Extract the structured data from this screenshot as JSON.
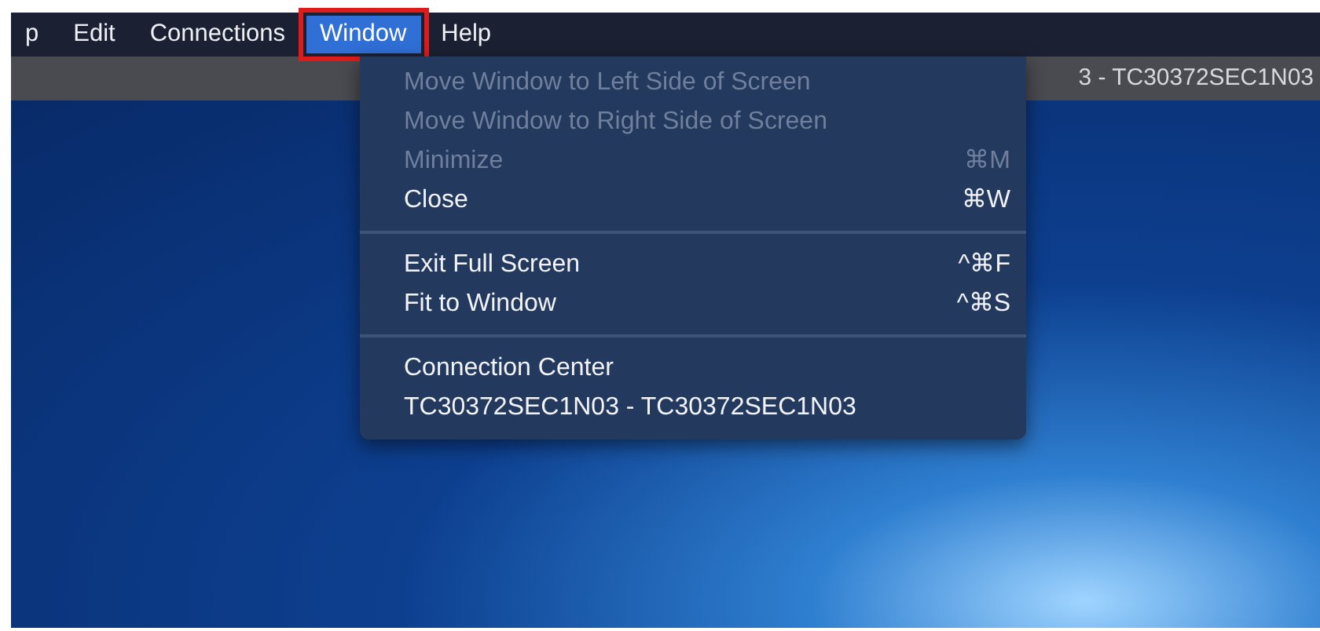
{
  "menu_bar": [
    {
      "label": "p",
      "selected": false,
      "annotated": false
    },
    {
      "label": "Edit",
      "selected": false,
      "annotated": false
    },
    {
      "label": "Connections",
      "selected": false,
      "annotated": false
    },
    {
      "label": "Window",
      "selected": true,
      "annotated": true
    },
    {
      "label": "Help",
      "selected": false,
      "annotated": false
    }
  ],
  "window": {
    "title": "3 - TC30372SEC1N03"
  },
  "window_menu": {
    "groups": [
      [
        {
          "label": "Move Window to Left Side of Screen",
          "disabled": true
        },
        {
          "label": "Move Window to Right Side of Screen",
          "disabled": true
        },
        {
          "label": "Minimize",
          "shortcut": "⌘M",
          "disabled": true
        },
        {
          "label": "Close",
          "shortcut": "⌘W",
          "disabled": false
        }
      ],
      [
        {
          "label": "Exit Full Screen",
          "shortcut": "^⌘F",
          "disabled": false
        },
        {
          "label": "Fit to Window",
          "shortcut": "^⌘S",
          "disabled": false
        }
      ],
      [
        {
          "label": "Connection Center",
          "disabled": false
        },
        {
          "label": "TC30372SEC1N03 - TC30372SEC1N03",
          "disabled": false
        }
      ]
    ]
  }
}
